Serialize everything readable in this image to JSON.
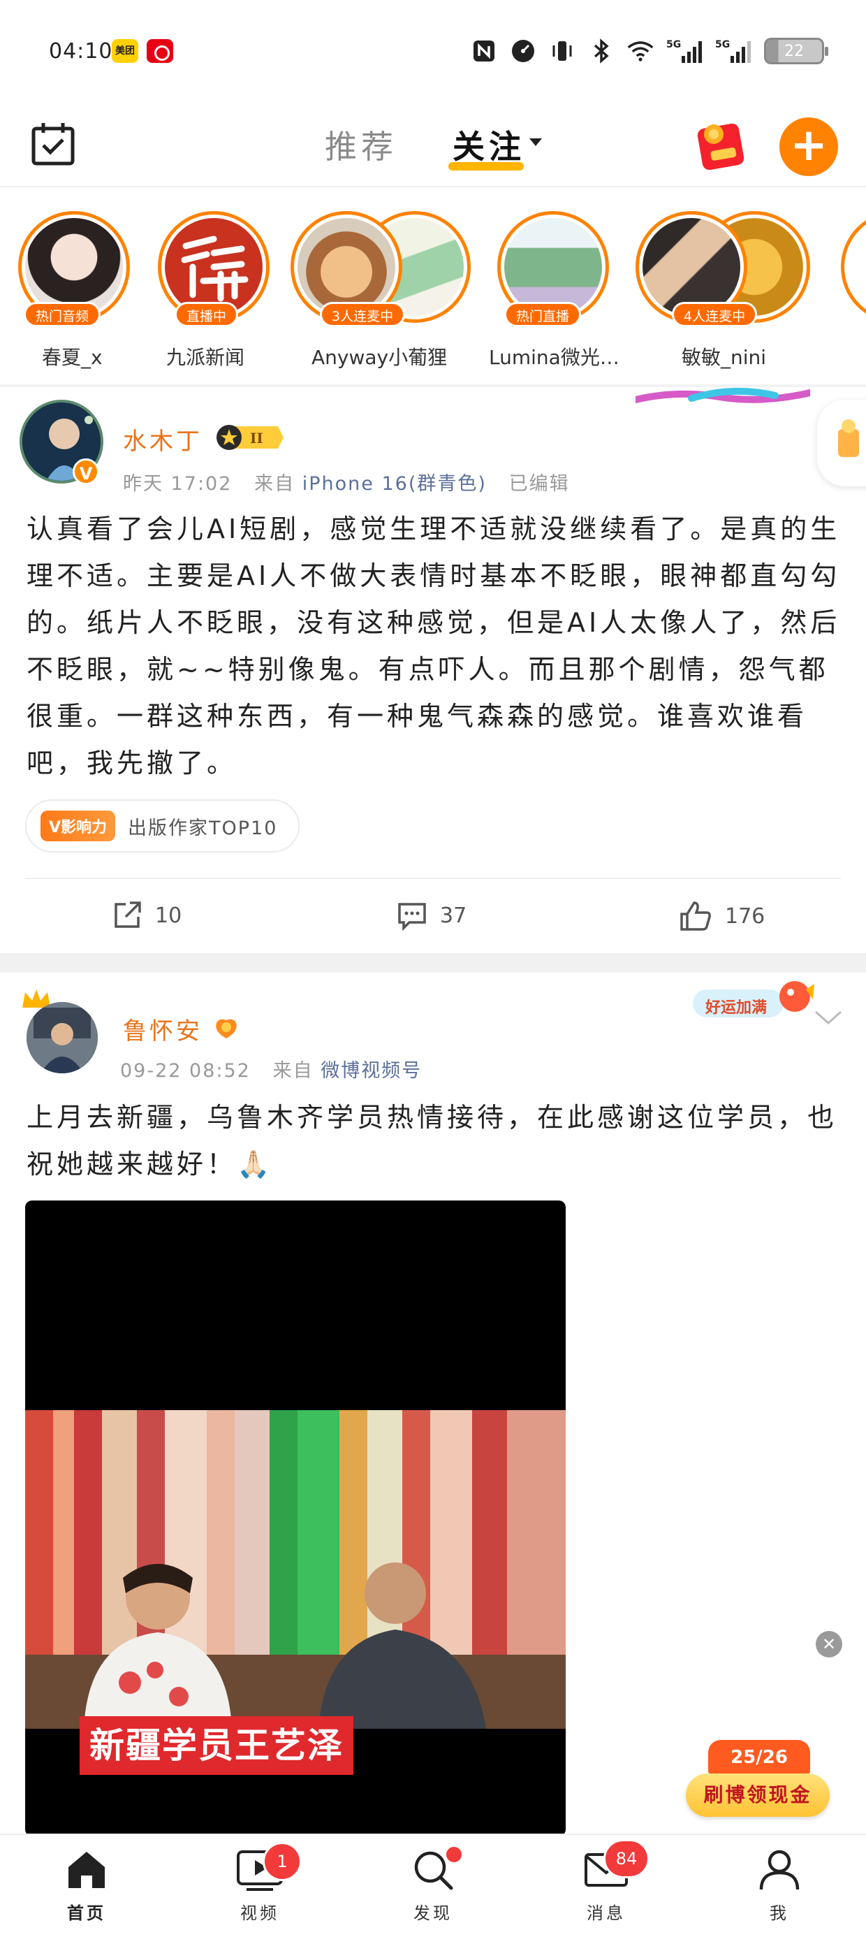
{
  "status_bar": {
    "time": "04:10",
    "app1_label": "美团",
    "battery": "22"
  },
  "header": {
    "tab_recommend": "推荐",
    "tab_following": "关注"
  },
  "stories": [
    {
      "name": "春夏_x",
      "badge": "热门音频"
    },
    {
      "name": "九派新闻",
      "badge": "直播中"
    },
    {
      "name": "Anyway小葡狸",
      "badge": "3人连麦中"
    },
    {
      "name": "Lumina微光…",
      "badge": "热门直播"
    },
    {
      "name": "敏敏_nini",
      "badge": "4人连麦中"
    }
  ],
  "post1": {
    "author": "水木丁",
    "rank": "II",
    "time": "昨天 17:02",
    "from_label": "来自",
    "source": "iPhone 16(群青色)",
    "edited": "已编辑",
    "text": "认真看了会儿AI短剧，感觉生理不适就没继续看了。是真的生理不适。主要是AI人不做大表情时基本不眨眼，眼神都直勾勾的。纸片人不眨眼，没有这种感觉，但是AI人太像人了，然后不眨眼，就~~特别像鬼。有点吓人。而且那个剧情，怨气都很重。一群这种东西，有一种鬼气森森的感觉。谁喜欢谁看吧，我先撤了。",
    "tag_badge": "V影响力",
    "tag_text": "出版作家TOP10",
    "reposts": "10",
    "comments": "37",
    "likes": "176"
  },
  "post2": {
    "author": "鲁怀安",
    "time": "09-22 08:52",
    "from_label": "来自",
    "source": "微博视频号",
    "luck_badge": "好运加满",
    "text": "上月去新疆，乌鲁木齐学员热情接待，在此感谢这位学员，也祝她越来越好！🙏🏻",
    "video_caption": "新疆学员王艺泽"
  },
  "promo": {
    "counter": "25/26",
    "button": "刷博领现金"
  },
  "nav": {
    "home": "首页",
    "video": "视频",
    "video_badge": "1",
    "discover": "发现",
    "messages": "消息",
    "messages_badge": "84",
    "me": "我"
  },
  "colors": {
    "accent": "#ff8200",
    "author": "#e9731a",
    "badge_red": "#f23a3a"
  }
}
